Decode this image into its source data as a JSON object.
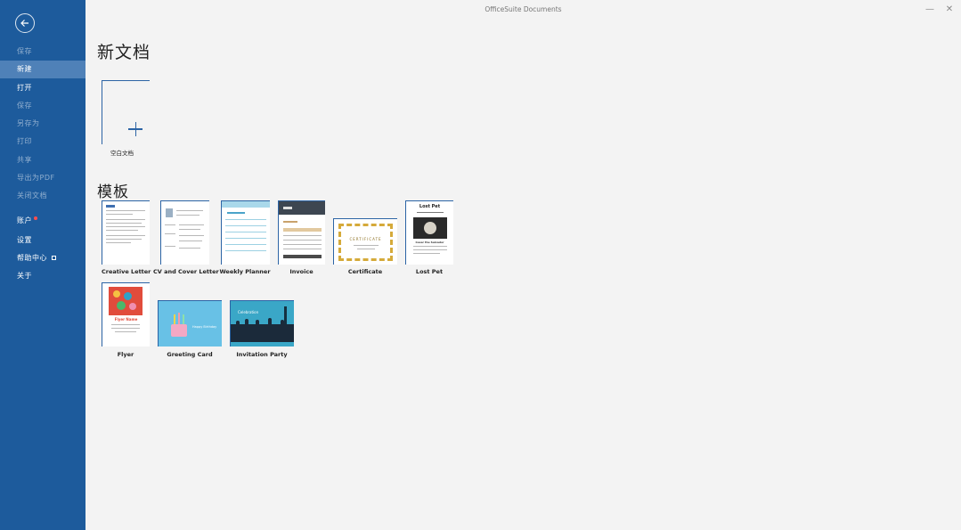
{
  "window": {
    "title": "OfficeSuite Documents",
    "minimize_glyph": "—",
    "close_glyph": "✕"
  },
  "sidebar": {
    "items": [
      {
        "label": "保存",
        "state": "disabled"
      },
      {
        "label": "新建",
        "state": "active"
      },
      {
        "label": "打开",
        "state": "enabled"
      },
      {
        "label": "保存",
        "state": "disabled"
      },
      {
        "label": "另存为",
        "state": "disabled"
      },
      {
        "label": "打印",
        "state": "disabled"
      },
      {
        "label": "共享",
        "state": "disabled"
      },
      {
        "label": "导出为PDF",
        "state": "disabled"
      },
      {
        "label": "关闭文档",
        "state": "disabled"
      },
      {
        "label": "账户",
        "state": "enabled"
      },
      {
        "label": "设置",
        "state": "enabled"
      },
      {
        "label": "帮助中心",
        "state": "enabled"
      },
      {
        "label": "关于",
        "state": "enabled"
      }
    ]
  },
  "new_doc": {
    "heading": "新文档",
    "blank_label": "空白文档"
  },
  "templates": {
    "heading": "模板",
    "items": [
      {
        "label": "Creative Letter"
      },
      {
        "label": "CV and Cover Letter"
      },
      {
        "label": "Weekly Planner"
      },
      {
        "label": "Invoice"
      },
      {
        "label": "Certificate",
        "preview_text": "CERTIFICATE"
      },
      {
        "label": "Lost Pet",
        "preview_title": "Lost Pet",
        "preview_name": "Cesar the Salvador"
      },
      {
        "label": "Flyer",
        "preview_title": "Flyer Name"
      },
      {
        "label": "Greeting Card",
        "preview_text": "Happy Birthday"
      },
      {
        "label": "Invitation Party",
        "preview_text": "Celebration"
      }
    ]
  },
  "colors": {
    "sidebar": "#1d5b9c",
    "accent": "#2c64a5",
    "active": "#4f81b8"
  }
}
